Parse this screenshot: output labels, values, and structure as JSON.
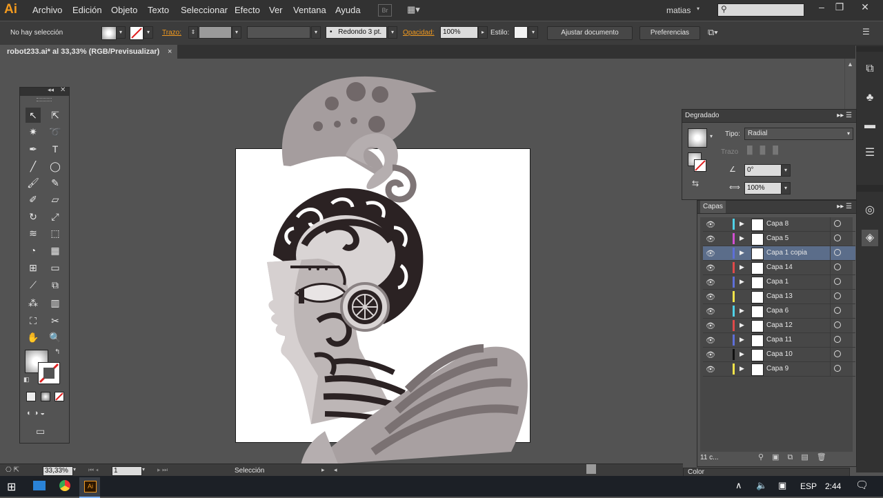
{
  "app": {
    "logo": "Ai"
  },
  "menu": [
    "Archivo",
    "Edición",
    "Objeto",
    "Texto",
    "Seleccionar",
    "Efecto",
    "Ver",
    "Ventana",
    "Ayuda"
  ],
  "bridge_label": "Br",
  "user": "matias",
  "control": {
    "selection_status": "No hay selección",
    "stroke_label": "Trazo:",
    "brush_label": "Redondo 3 pt.",
    "opacity_label": "Opacidad:",
    "opacity_value": "100%",
    "style_label": "Estilo:",
    "adjust_button": "Ajustar documento",
    "prefs_button": "Preferencias"
  },
  "document_tab": {
    "title": "robot233.ai* al 33,33% (RGB/Previsualizar)",
    "close": "×"
  },
  "gradient_panel": {
    "title": "Degradado",
    "type_label": "Tipo:",
    "type_value": "Radial",
    "stroke_label": "Trazo",
    "angle_value": "0°",
    "ratio_value": "100%"
  },
  "layers_panel": {
    "title": "Capas",
    "count": "11 c...",
    "layers": [
      {
        "name": "Capa 8",
        "color": "#4fd2e8",
        "selected": false,
        "has_arrow": true
      },
      {
        "name": "Capa 5",
        "color": "#d14fd1",
        "selected": false,
        "has_arrow": true
      },
      {
        "name": "Capa 1 copia",
        "color": "#5e6fd8",
        "selected": true,
        "has_arrow": true
      },
      {
        "name": "Capa 14",
        "color": "#e04a4a",
        "selected": false,
        "has_arrow": true
      },
      {
        "name": "Capa 1",
        "color": "#5e6fd8",
        "selected": false,
        "has_arrow": true
      },
      {
        "name": "Capa 13",
        "color": "#f2e34a",
        "selected": false,
        "has_arrow": false
      },
      {
        "name": "Capa 6",
        "color": "#4fd2e8",
        "selected": false,
        "has_arrow": true
      },
      {
        "name": "Capa 12",
        "color": "#e04a4a",
        "selected": false,
        "has_arrow": true
      },
      {
        "name": "Capa 11",
        "color": "#5e6fd8",
        "selected": false,
        "has_arrow": true
      },
      {
        "name": "Capa 10",
        "color": "#111111",
        "selected": false,
        "has_arrow": true
      },
      {
        "name": "Capa 9",
        "color": "#f2e34a",
        "selected": false,
        "has_arrow": true
      }
    ]
  },
  "color_panel_title": "Color",
  "status": {
    "zoom": "33,33%",
    "artboard": "1",
    "tool": "Selección"
  },
  "taskbar": {
    "language": "ESP",
    "time": "2:44",
    "ai_label": "Ai"
  }
}
